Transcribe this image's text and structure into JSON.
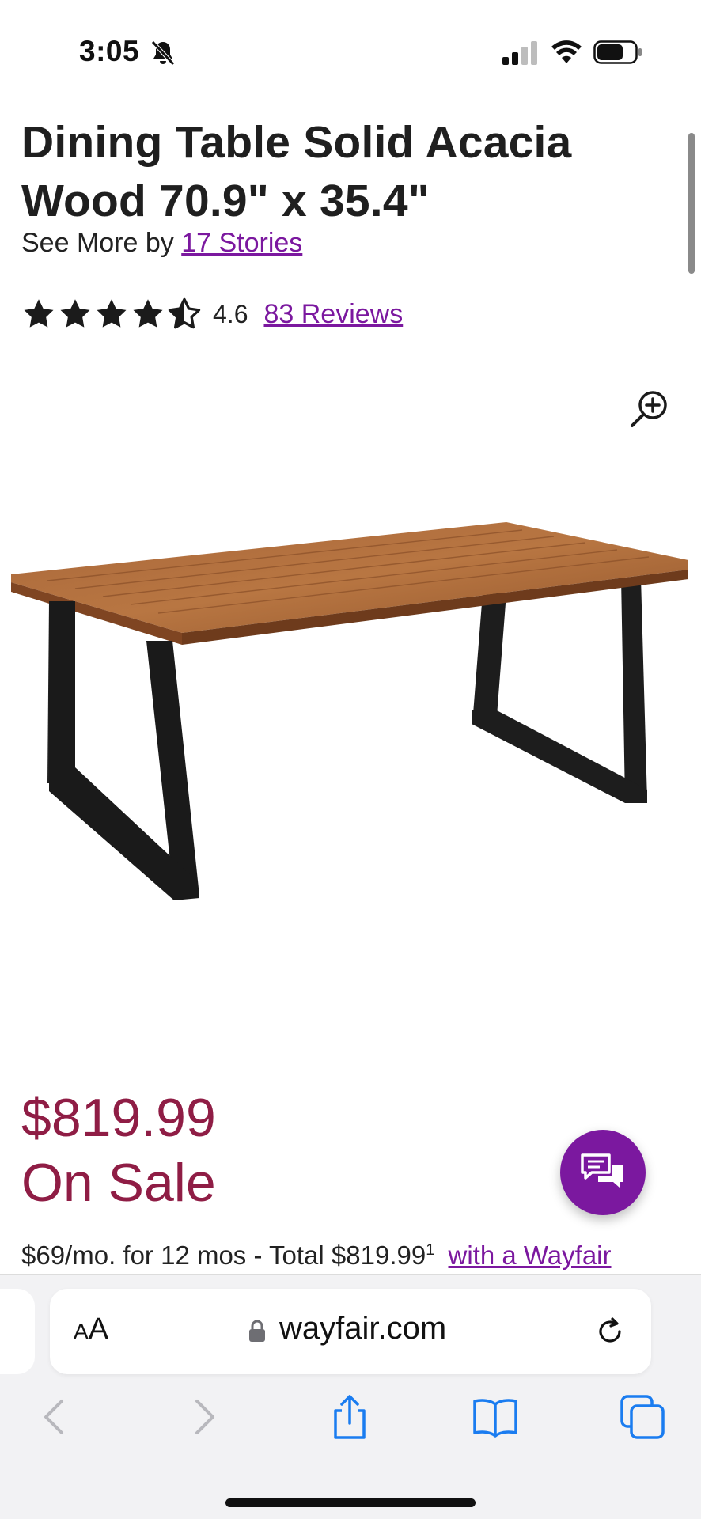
{
  "status_bar": {
    "time": "3:05"
  },
  "product": {
    "title": "Dining Table Solid Acacia Wood 70.9\" x 35.4\"",
    "see_more_prefix": "See More by",
    "brand": "17 Stories",
    "rating": "4.6",
    "rating_stars_value": 4.6,
    "reviews": "83 Reviews"
  },
  "pricing": {
    "price": "$819.99",
    "sale_label": "On Sale",
    "financing_text": "$69/mo. for 12 mos - Total $819.99",
    "financing_footnote": "1",
    "financing_link": "with a Wayfair"
  },
  "browser": {
    "aa_small": "A",
    "aa_large": "A",
    "domain": "wayfair.com"
  },
  "icons": {
    "zoom": "zoom-in-icon",
    "chat": "chat-icon",
    "lock": "lock-icon",
    "reload": "reload-icon",
    "back": "back-chevron-icon",
    "forward": "forward-chevron-icon",
    "share": "share-icon",
    "bookmarks": "bookmarks-icon",
    "tabs": "tabs-icon"
  },
  "colors": {
    "accent": "#7b189f",
    "price": "#8f1d45",
    "browser_blue": "#1a7cf0"
  }
}
